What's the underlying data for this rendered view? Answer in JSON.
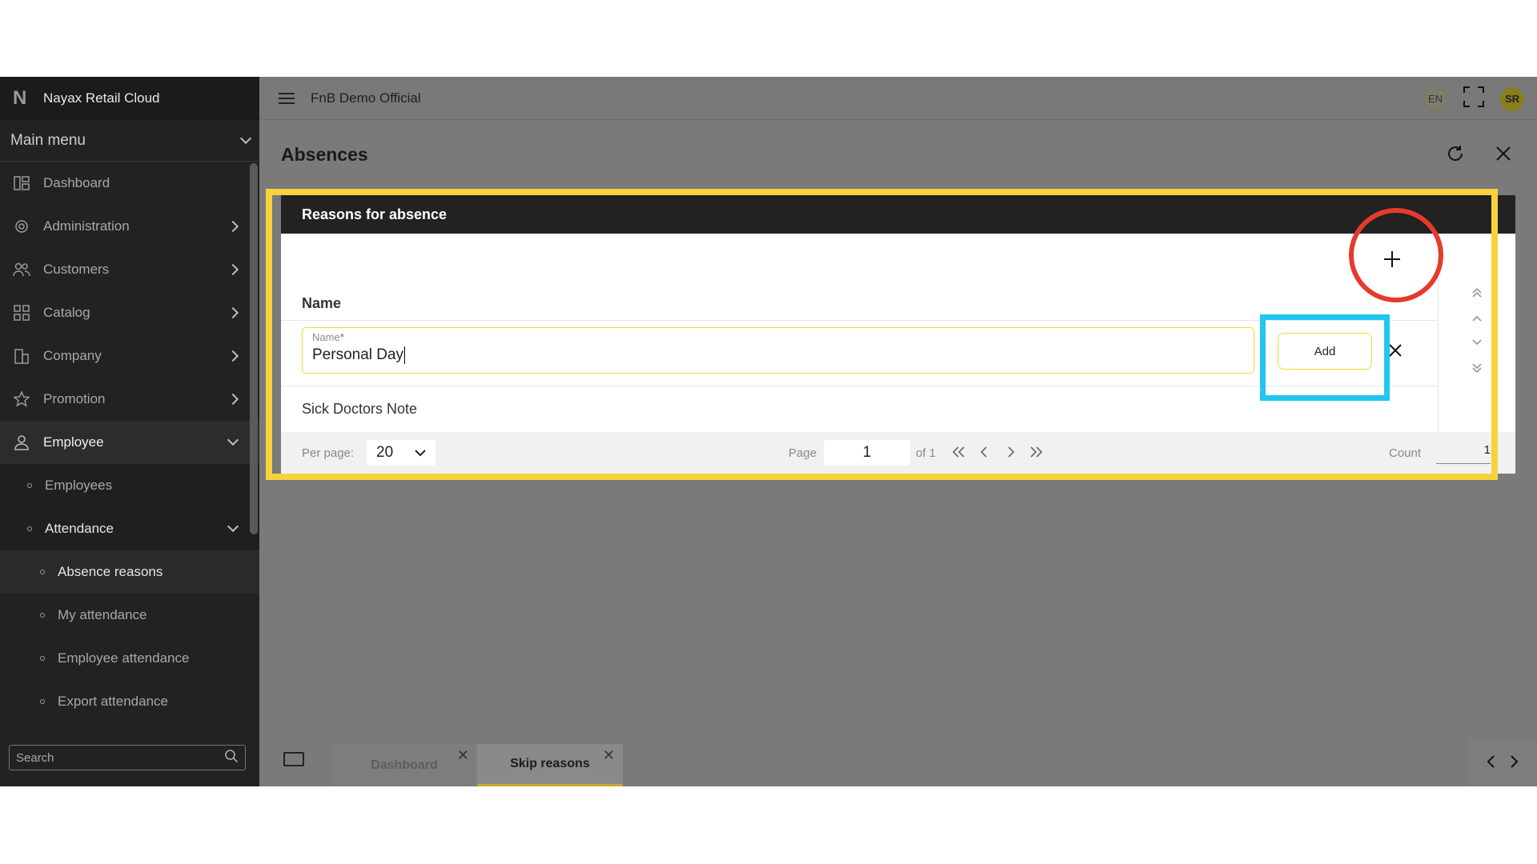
{
  "sidebar": {
    "brand": "Nayax Retail Cloud",
    "brand_logo": "N",
    "main_menu": "Main menu",
    "items": [
      {
        "label": "Dashboard",
        "icon": "dashboard-icon"
      },
      {
        "label": "Administration",
        "icon": "admin-gear-icon"
      },
      {
        "label": "Customers",
        "icon": "customers-icon"
      },
      {
        "label": "Catalog",
        "icon": "catalog-icon"
      },
      {
        "label": "Company",
        "icon": "company-icon"
      },
      {
        "label": "Promotion",
        "icon": "star-icon"
      },
      {
        "label": "Employee",
        "icon": "employee-icon"
      }
    ],
    "employee_sub": [
      "Employees",
      "Attendance"
    ],
    "attendance_sub": [
      "Absence reasons",
      "My attendance",
      "Employee attendance",
      "Export attendance"
    ],
    "search_placeholder": "Search"
  },
  "topbar": {
    "org_name": "FnB Demo Official",
    "lang": "EN",
    "user_initials": "SR"
  },
  "page": {
    "title": "Absences"
  },
  "panel": {
    "title": "Reasons for absence",
    "column_name": "Name",
    "edit_label": "Name",
    "edit_required": "*",
    "edit_value": "Personal Day",
    "add_label": "Add",
    "rows": [
      "Sick Doctors Note"
    ]
  },
  "footer": {
    "per_page_label": "Per page:",
    "per_page_value": "20",
    "page_label": "Page",
    "page_value": "1",
    "of_label": "of 1",
    "count_label": "Count",
    "count_value": "1"
  },
  "tabs": [
    {
      "label": "Dashboard",
      "active": false
    },
    {
      "label": "Skip reasons",
      "active": true
    }
  ],
  "colors": {
    "accent_yellow": "#f6d23c",
    "highlight_blue": "#22c6ef",
    "highlight_red": "#e53a2c",
    "sidebar_bg": "#222222"
  }
}
